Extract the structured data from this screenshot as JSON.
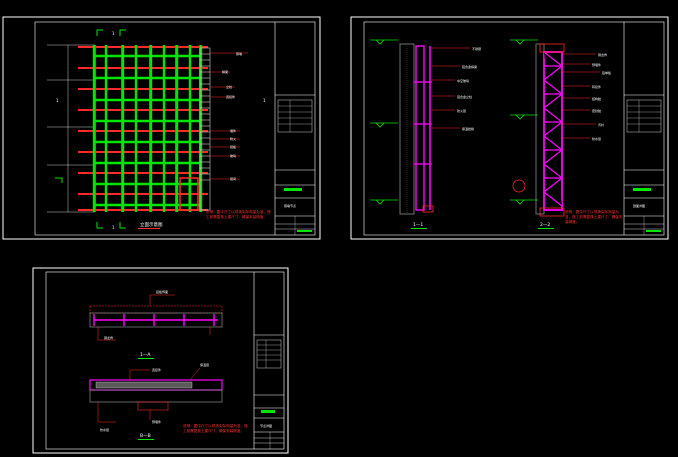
{
  "sheets": [
    {
      "id": "sheet-1",
      "elevation_title": "立面示意图",
      "grid_marks": [
        "1",
        "1",
        "1",
        "1"
      ],
      "callouts": [
        "幕墙",
        "横梁",
        "立柱",
        "连接件",
        "埋件",
        "防火",
        "铝板",
        "玻璃",
        "层间"
      ],
      "note": "说明：图中尺寸以现场实际测量为准，施工前需复核土建尺寸，确保安装精度。",
      "titleblock_rows": [
        "",
        "",
        "",
        "",
        "",
        "",
        ""
      ],
      "titleblock_name": "幕墙节点"
    },
    {
      "id": "sheet-2",
      "section_a": "1—1",
      "section_b": "2—2",
      "callouts_a": [
        "不锈钢",
        "铝合金横梁",
        "中空玻璃",
        "铝合金立柱",
        "防火层",
        "保温岩棉"
      ],
      "callouts_b": [
        "钢龙骨",
        "预埋件",
        "铝单板",
        "转接件",
        "结构胶",
        "密封胶",
        "背衬",
        "防水层"
      ],
      "note": "说明：图中尺寸以现场实际测量为准，施工前需复核土建尺寸，确保安装精度。",
      "titleblock_name": "剖面详图"
    },
    {
      "id": "sheet-3",
      "section_a": "1—A",
      "section_b": "B—B",
      "callouts": [
        "铝板饰面",
        "钢龙骨",
        "连接件",
        "保温层",
        "防水层",
        "预埋件"
      ],
      "note": "说明：图中尺寸以现场实际测量为准，施工前需复核土建尺寸，确保安装精度。",
      "titleblock_name": "节点详图"
    }
  ],
  "colors": {
    "background": "#000000",
    "border": "#ffffff",
    "grid_green": "#00e600",
    "grid_red": "#ff2a2a",
    "magenta": "#ff00ff",
    "note_red": "#ff3030",
    "wall_gray": "#8c8c8c"
  }
}
